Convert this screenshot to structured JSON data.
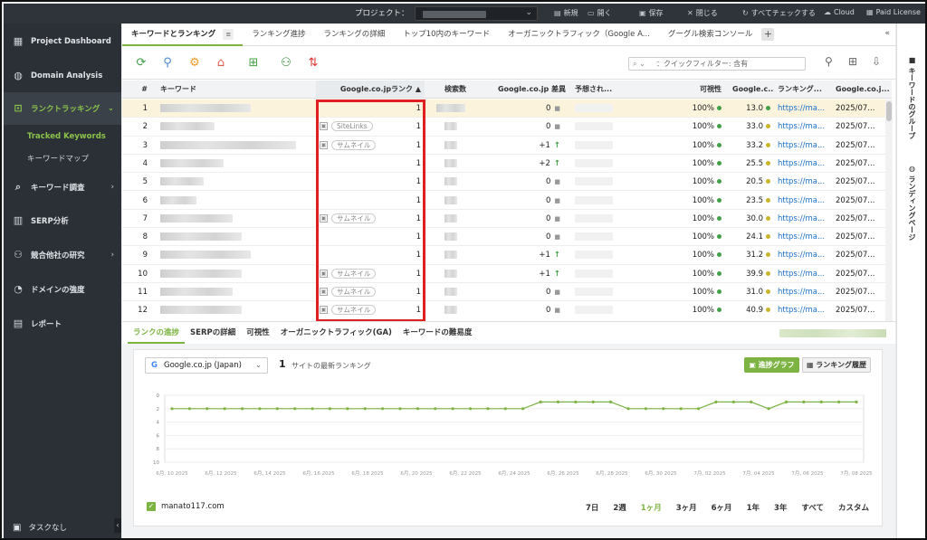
{
  "topbar": {
    "project_label": "プロジェクト：",
    "items": [
      {
        "icon": "new-icon",
        "label": "新規"
      },
      {
        "icon": "open-icon",
        "label": "開く"
      },
      {
        "icon": "save-icon",
        "label": "保存"
      },
      {
        "icon": "close-icon",
        "label": "閉じる"
      },
      {
        "icon": "refresh-icon",
        "label": "すべてチェックする"
      },
      {
        "icon": "cloud-icon",
        "label": "Cloud"
      },
      {
        "icon": "license-icon",
        "label": "Paid License"
      }
    ]
  },
  "sidebar": {
    "items": [
      {
        "icon": "dashboard-icon",
        "label": "Project Dashboard"
      },
      {
        "icon": "globe-icon",
        "label": "Domain Analysis"
      },
      {
        "icon": "chart-icon",
        "label": "ランクトラッキング"
      },
      {
        "icon": "search-icon",
        "label": "キーワード調査"
      },
      {
        "icon": "bar-icon",
        "label": "SERP分析"
      },
      {
        "icon": "user-icon",
        "label": "競合他社の研究"
      },
      {
        "icon": "gauge-icon",
        "label": "ドメインの強度"
      },
      {
        "icon": "doc-icon",
        "label": "レポート"
      }
    ],
    "sub": [
      "Tracked Keywords",
      "キーワードマップ"
    ],
    "tasks": "タスクなし"
  },
  "tabs": [
    "キーワードとランキング",
    "ランキング進捗",
    "ランキングの詳細",
    "トップ10内のキーワード",
    "オーガニックトラフィック（Google A...",
    "グーグル検索コンソール"
  ],
  "filter": {
    "placeholder": "：クイックフィルター: 含有"
  },
  "table": {
    "headers": [
      "#",
      "キーワード",
      "Google.co.jpランク ▲",
      "検索数",
      "Google.co.jp 差異",
      "予想され...",
      "可視性",
      "Google.c...",
      "ランキング...",
      "Google.co.j..."
    ],
    "rows": [
      {
        "n": "1",
        "badge": "",
        "rank": "1",
        "diff": "0",
        "arrow": "",
        "vis": "100%",
        "score": "13.0",
        "url": "https://ma...",
        "date": "2025/07..."
      },
      {
        "n": "2",
        "badge": "SiteLinks",
        "rank": "1",
        "diff": "0",
        "arrow": "",
        "vis": "100%",
        "score": "33.0",
        "url": "https://ma...",
        "date": "2025/07..."
      },
      {
        "n": "3",
        "badge": "サムネイル",
        "rank": "1",
        "diff": "+1",
        "arrow": "↑",
        "vis": "100%",
        "score": "33.2",
        "url": "https://ma...",
        "date": "2025/07..."
      },
      {
        "n": "4",
        "badge": "",
        "rank": "1",
        "diff": "+2",
        "arrow": "↑",
        "vis": "100%",
        "score": "25.5",
        "url": "https://ma...",
        "date": "2025/07..."
      },
      {
        "n": "5",
        "badge": "",
        "rank": "1",
        "diff": "0",
        "arrow": "",
        "vis": "100%",
        "score": "20.5",
        "url": "https://ma...",
        "date": "2025/07..."
      },
      {
        "n": "6",
        "badge": "",
        "rank": "1",
        "diff": "0",
        "arrow": "",
        "vis": "100%",
        "score": "23.5",
        "url": "https://ma...",
        "date": "2025/07..."
      },
      {
        "n": "7",
        "badge": "サムネイル",
        "rank": "1",
        "diff": "0",
        "arrow": "",
        "vis": "100%",
        "score": "30.0",
        "url": "https://ma...",
        "date": "2025/07..."
      },
      {
        "n": "8",
        "badge": "",
        "rank": "1",
        "diff": "0",
        "arrow": "",
        "vis": "100%",
        "score": "24.1",
        "url": "https://ma...",
        "date": "2025/07..."
      },
      {
        "n": "9",
        "badge": "",
        "rank": "1",
        "diff": "+1",
        "arrow": "↑",
        "vis": "100%",
        "score": "31.2",
        "url": "https://ma...",
        "date": "2025/07..."
      },
      {
        "n": "10",
        "badge": "サムネイル",
        "rank": "1",
        "diff": "+1",
        "arrow": "↑",
        "vis": "100%",
        "score": "39.9",
        "url": "https://ma...",
        "date": "2025/07..."
      },
      {
        "n": "11",
        "badge": "サムネイル",
        "rank": "1",
        "diff": "0",
        "arrow": "",
        "vis": "100%",
        "score": "31.0",
        "url": "https://ma...",
        "date": "2025/07..."
      },
      {
        "n": "12",
        "badge": "サムネイル",
        "rank": "1",
        "diff": "0",
        "arrow": "",
        "vis": "100%",
        "score": "40.9",
        "url": "https://ma...",
        "date": "2025/07..."
      }
    ]
  },
  "right_rail": [
    "キーワードのグループ",
    "ランディングページ"
  ],
  "bottom": {
    "tabs": [
      "ランクの進捗",
      "SERPの詳細",
      "可視性",
      "オーガニックトラフィック(GA)",
      "キーワードの難易度"
    ],
    "engine": "Google.co.jp (Japan)",
    "rank": "1",
    "rank_label": "サイトの最新ランキング",
    "btn_graph": "進捗グラフ",
    "btn_history": "ランキング履歴",
    "legend": "manato117.com",
    "ranges": [
      "7日",
      "2週",
      "1ヶ月",
      "3ヶ月",
      "6ヶ月",
      "1年",
      "3年",
      "すべて",
      "カスタム"
    ]
  },
  "chart_data": {
    "type": "line",
    "series": [
      {
        "name": "manato117.com",
        "values": [
          2,
          2,
          2,
          2,
          2,
          2,
          2,
          2,
          2,
          2,
          2,
          2,
          2,
          2,
          2,
          2,
          2,
          2,
          2,
          2,
          2,
          1,
          1,
          1,
          1,
          1,
          2,
          2,
          2,
          2,
          2,
          1,
          1,
          1,
          2,
          1,
          1,
          1,
          1,
          1
        ]
      }
    ],
    "x_ticks": [
      "6月, 10 2025",
      "6月, 12 2025",
      "6月, 14 2025",
      "6月, 16 2025",
      "6月, 18 2025",
      "6月, 20 2025",
      "6月, 22 2025",
      "6月, 24 2025",
      "6月, 26 2025",
      "6月, 28 2025",
      "6月, 30 2025",
      "7月, 02 2025",
      "7月, 04 2025",
      "7月, 06 2025",
      "7月, 08 2025"
    ],
    "y_ticks": [
      "0",
      "2",
      "4",
      "6",
      "8",
      "10"
    ],
    "ylim": [
      0,
      10
    ],
    "y_reversed": true,
    "grid": true,
    "color": "#7cb342"
  }
}
